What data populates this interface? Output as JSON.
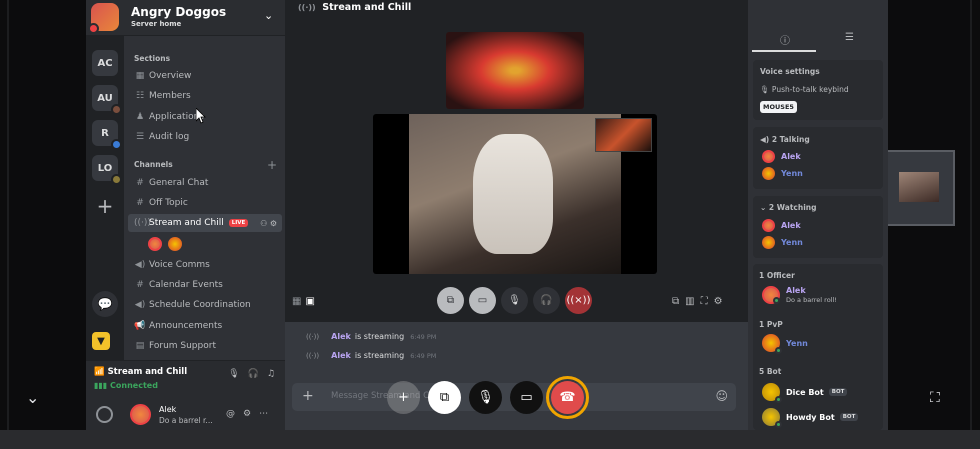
{
  "server": {
    "name": "Angry Doggos",
    "subtitle": "Server home"
  },
  "rail": [
    "AC",
    "AU",
    "R",
    "LO"
  ],
  "sections": {
    "heading": "Sections",
    "items": [
      "Overview",
      "Members",
      "Applications",
      "Audit log"
    ]
  },
  "channels": {
    "heading": "Channels",
    "items": [
      "General Chat",
      "Off Topic",
      "Stream and Chill",
      "Voice Comms",
      "Calendar Events",
      "Schedule Coordination",
      "Announcements",
      "Forum Support"
    ],
    "live_label": "LIVE"
  },
  "voice_panel": {
    "channel": "Stream and Chill",
    "status": "Connected"
  },
  "user_panel": {
    "name": "Alek",
    "status": "Do a barrel r..."
  },
  "top_bar": {
    "title": "Stream and Chill"
  },
  "chat": {
    "messages": [
      {
        "user": "Alek",
        "text": "is streaming",
        "time": "6:49 PM"
      },
      {
        "user": "Alek",
        "text": "is streaming",
        "time": "6:49 PM"
      }
    ],
    "placeholder": "Message Stream and Chill"
  },
  "members": {
    "voice_settings": {
      "title": "Voice settings",
      "ptt_label": "Push-to-talk keybind",
      "key": "MOUSE5"
    },
    "talking": {
      "title": "2 Talking",
      "users": [
        "Alek",
        "Yenn"
      ]
    },
    "watching": {
      "title": "2 Watching",
      "users": [
        "Alek",
        "Yenn"
      ]
    },
    "groups": [
      {
        "title": "1 Officer",
        "user": "Alek",
        "status": "Do a barrel roll!"
      },
      {
        "title": "1 PvP",
        "user": "Yenn"
      },
      {
        "title": "5 Bot",
        "bots": [
          "Dice Bot",
          "Howdy Bot"
        ],
        "bot_tag": "BOT"
      }
    ]
  },
  "colors": {
    "accent": "#5865f2",
    "live": "#ed4245",
    "connected": "#3ba55d",
    "hangup_outline": "#f0a500"
  }
}
